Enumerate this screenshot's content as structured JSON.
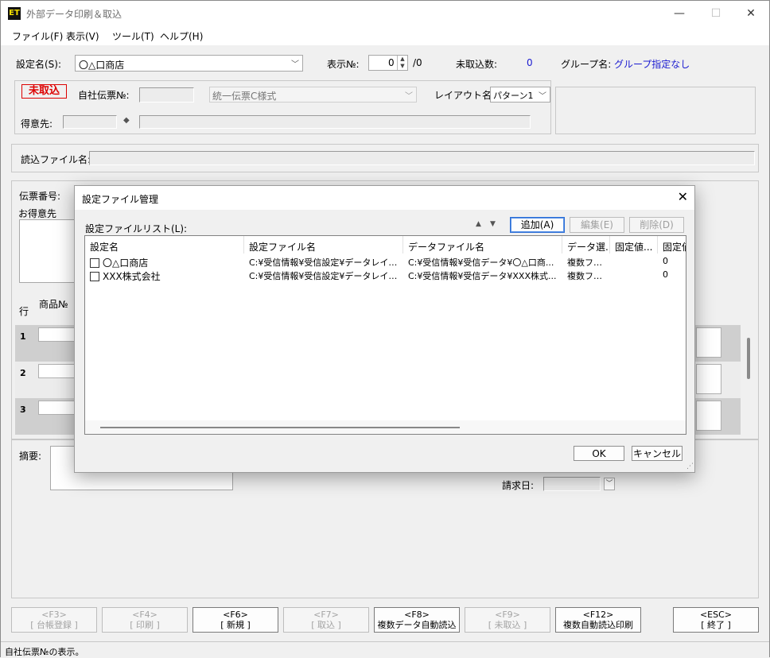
{
  "window": {
    "title": "外部データ印刷＆取込",
    "icon": "ET",
    "minimize": "—",
    "maximize": "☐",
    "close": "✕"
  },
  "menu": [
    "ファイル(F)",
    "表示(V)",
    "ツール(T)",
    "ヘルプ(H)"
  ],
  "top": {
    "setting_label": "設定名(S):",
    "setting_value": "〇△口商店",
    "display_no_label": "表示№:",
    "display_no_value": "0",
    "display_total": "/0",
    "unread_count_label": "未取込数:",
    "unread_count_value": "0",
    "group_label": "グループ名:",
    "group_value": "グループ指定なし"
  },
  "header_panel": {
    "badge": "未取込",
    "own_slip_label": "自社伝票№:",
    "slip_style": "統一伝票C様式",
    "layout_label": "レイアウト名:",
    "layout_value": "パターン1",
    "customer_label": "得意先:",
    "read_file_label": "読込ファイル名:"
  },
  "slip": {
    "slip_no_label": "伝票番号:",
    "customer_label": "お得意先",
    "row_label": "行",
    "product_no_label": "商品№",
    "rows": [
      "1",
      "2",
      "3"
    ],
    "summary_label": "摘要:",
    "bill_date_label": "請求日:"
  },
  "fkeys": [
    {
      "key": "<F3>",
      "label": "[ 台帳登録 ]",
      "enabled": false
    },
    {
      "key": "<F4>",
      "label": "[ 印刷 ]",
      "enabled": false
    },
    {
      "key": "<F6>",
      "label": "[ 新規 ]",
      "enabled": true
    },
    {
      "key": "<F7>",
      "label": "[ 取込 ]",
      "enabled": false
    },
    {
      "key": "<F8>",
      "label": "複数データ自動読込",
      "enabled": true
    },
    {
      "key": "<F9>",
      "label": "[ 未取込 ]",
      "enabled": false
    },
    {
      "key": "<F12>",
      "label": "複数自動読込印刷",
      "enabled": true
    },
    {
      "key": "<ESC>",
      "label": "[ 終了 ]",
      "enabled": true
    }
  ],
  "status_text": "自社伝票№の表示。",
  "dialog": {
    "title": "設定ファイル管理",
    "list_label": "設定ファイルリスト(L):",
    "add": "追加(A)",
    "edit": "編集(E)",
    "delete": "削除(D)",
    "columns": [
      "設定名",
      "設定ファイル名",
      "データファイル名",
      "データ選...",
      "固定値...",
      "固定値"
    ],
    "rows": [
      {
        "name": "〇△口商店",
        "setting_file": "C:¥受信情報¥受信設定¥データレイア...",
        "data_file": "C:¥受信情報¥受信データ¥〇△口商...",
        "data_sel": "複数ファ...",
        "fixed1": "",
        "fixed2": "0"
      },
      {
        "name": "XXX株式会社",
        "setting_file": "C:¥受信情報¥受信設定¥データレイア...",
        "data_file": "C:¥受信情報¥受信データ¥XXX株式...",
        "data_sel": "複数ファ...",
        "fixed1": "",
        "fixed2": "0"
      }
    ],
    "ok": "OK",
    "cancel": "キャンセル"
  }
}
